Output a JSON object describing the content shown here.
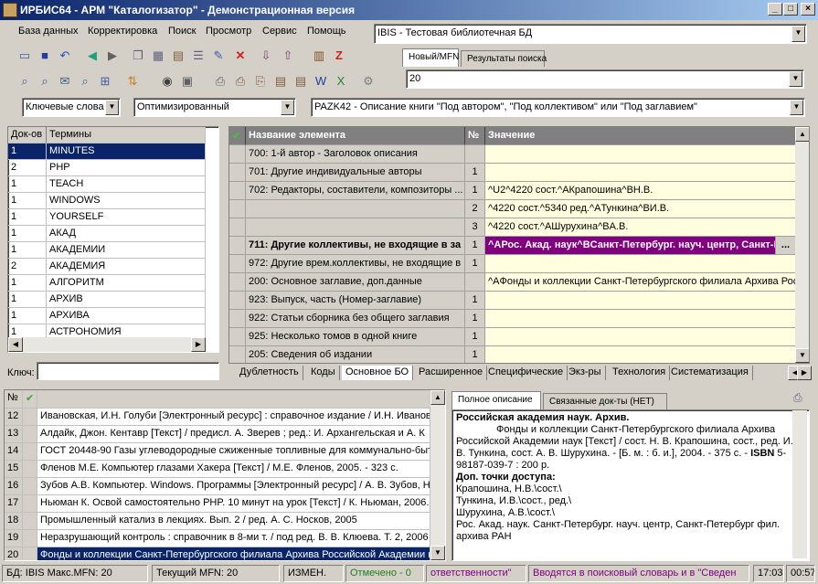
{
  "window": {
    "title": "ИРБИС64 - АРМ \"Каталогизатор\" - Демонстрационная версия"
  },
  "menu": [
    "База данных",
    "Корректировка",
    "Поиск",
    "Просмотр",
    "Сервис",
    "Помощь"
  ],
  "db_combo": "IBIS - Тестовая библиотечная БД",
  "top_tabs": [
    "Новый/MFN",
    "Результаты поиска"
  ],
  "mfn_value": "20",
  "search_bar": {
    "mode": "Ключевые слова",
    "optimization": "Оптимизированный",
    "worksheet": "PAZK42 - Описание книги \"Под автором\", \"Под коллективом\" или \"Под заглавием\""
  },
  "dict": {
    "headers": [
      "Док-ов",
      "Термины"
    ],
    "rows": [
      [
        "1",
        "MINUTES"
      ],
      [
        "2",
        "PHP"
      ],
      [
        "1",
        "TEACH"
      ],
      [
        "1",
        "WINDOWS"
      ],
      [
        "1",
        "YOURSELF"
      ],
      [
        "1",
        "АКАД"
      ],
      [
        "1",
        "АКАДЕМИИ"
      ],
      [
        "2",
        "АКАДЕМИЯ"
      ],
      [
        "1",
        "АЛГОРИТМ"
      ],
      [
        "1",
        "АРХИВ"
      ],
      [
        "1",
        "АРХИВА"
      ],
      [
        "1",
        "АСТРОНОМИЯ"
      ]
    ],
    "key_label": "Ключ:"
  },
  "fields": {
    "headers": [
      "Название элемента",
      "№",
      "Значение"
    ],
    "rows": [
      {
        "name": "700: 1-й автор - Заголовок описания",
        "n": "",
        "v": "",
        "bold": false
      },
      {
        "name": "701: Другие индивидуальные авторы",
        "n": "1",
        "v": "",
        "bold": false
      },
      {
        "name": "702: Редакторы, составители, композиторы ...",
        "n": "1",
        "v": "^U2^4220 сост.^AКрапошина^BН.В.",
        "bold": false
      },
      {
        "name": "",
        "n": "2",
        "v": "^4220 сост.^5340 ред.^AТункина^BИ.В.",
        "bold": false
      },
      {
        "name": "",
        "n": "3",
        "v": "^4220 сост.^AШурухина^BА.В.",
        "bold": false
      },
      {
        "name": "711: Другие коллективы, не входящие в за",
        "n": "1",
        "v": "^AРос. Акад. наук^BСанкт-Петербург. науч. центр, Санкт-Пете",
        "bold": true
      },
      {
        "name": "972: Другие врем.коллективы, не входящие в",
        "n": "1",
        "v": "",
        "bold": false
      },
      {
        "name": "200: Основное заглавие, доп.данные",
        "n": "",
        "v": "^AФонды и коллекции Санкт-Петербургского филиала Архива Рос",
        "bold": false
      },
      {
        "name": "923: Выпуск, часть (Номер-заглавие)",
        "n": "1",
        "v": "",
        "bold": false
      },
      {
        "name": "922: Статьи сборника без общего заглавия",
        "n": "1",
        "v": "",
        "bold": false
      },
      {
        "name": "925: Несколько томов в одной книге",
        "n": "1",
        "v": "",
        "bold": false
      },
      {
        "name": "205: Сведения об издании",
        "n": "1",
        "v": "",
        "bold": false
      }
    ]
  },
  "field_tabs": [
    "Дублетность",
    "Коды",
    "Основное БО",
    "Расширенное",
    "Специфические",
    "Экз-ры",
    "Технология",
    "Систематизация"
  ],
  "docs": {
    "header": "№",
    "rows": [
      [
        "12",
        "Ивановская, И.Н. Голуби [Электронный ресурс] : справочное издание / И.Н. Иванов"
      ],
      [
        "13",
        "Алдайк, Джон. Кентавр [Текст] / предисл. А. Зверев ; ред.: И. Архангельская и А. К"
      ],
      [
        "14",
        "ГОСТ 20448-90 Газы углеводородные сжиженные топливные для коммунально-быт"
      ],
      [
        "15",
        "Фленов М.Е. Компьютер глазами Хакера [Текст] / М.Е. Фленов, 2005. - 323 с."
      ],
      [
        "16",
        "Зубов А.В. Компьютер. Windows. Программы [Электронный ресурс] / А. В. Зубов, Н"
      ],
      [
        "17",
        "Ньюман К. Освой самостоятельно PHP. 10 минут на урок [Текст] / К. Ньюман, 2006."
      ],
      [
        "18",
        "Промышленный катализ в лекциях. Вып. 2 / ред. А. С. Носков, 2005"
      ],
      [
        "19",
        "Неразрушающий контроль : справочник в 8-ми т. / под ред. В. В. Клюева. Т. 2, 2006"
      ],
      [
        "20",
        "Фонды и коллекции Санкт-Петербургского филиала Архива Российской Академии н"
      ]
    ]
  },
  "desc_tabs": [
    "Полное описание",
    "Связанные док-ты (НЕТ)"
  ],
  "description": {
    "heading": "Российская академия наук. Архив.",
    "body1": "Фонды и коллекции Санкт-Петербургского филиала Архива Российской Академии наук [Текст] / сост. Н. В. Крапошина, сост., ред. И. В. Тункина, сост. А. В. Шурухина. - [Б. м. : б. и.], 2004. - 375 с. - ",
    "isbn_label": "ISBN",
    "isbn": " 5-98187-039-7 : 200 р.",
    "access_label": "Доп. точки доступа:",
    "access": [
      "Крапошина, Н.В.\\сост.\\",
      "Тункина, И.В.\\сост., ред.\\",
      "Шурухина, А.В.\\сост.\\",
      "Рос. Акад. наук. Санкт-Петербург. науч. центр, Санкт-Петербург фил. архива РАН"
    ]
  },
  "status": {
    "db": "БД: IBIS Макс.MFN: 20",
    "cur": "Текущий MFN: 20",
    "changed": "ИЗМЕН.",
    "marked": "Отмечено - 0",
    "msg1": "ответственности\"",
    "msg2": "Вводятся в поисковый словарь и в \"Сведен",
    "time1": "17:03",
    "time2": "00:57"
  },
  "colors": {
    "selected": "#0a246a",
    "highlight_edit": "#800080",
    "yellow": "#ffffe0"
  }
}
